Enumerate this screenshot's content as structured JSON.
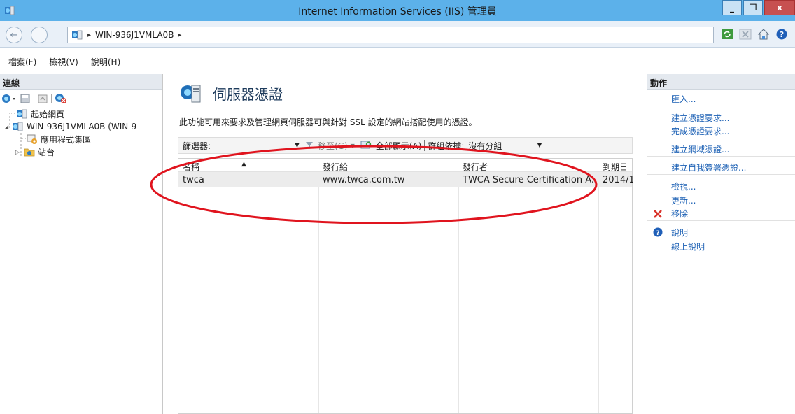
{
  "window": {
    "title": "Internet Information Services (IIS) 管理員",
    "minimize": "_",
    "maximize": "❐",
    "close": "x"
  },
  "address": {
    "path_separator": "▸",
    "server": "WIN-936J1VMLA0B",
    "trailing_separator": "▸"
  },
  "menu": {
    "items": [
      "檔案(F)",
      "檢視(V)",
      "說明(H)"
    ]
  },
  "connections": {
    "header": "連線",
    "tree": [
      {
        "label": "起始網頁"
      },
      {
        "label": "WIN-936J1VMLA0B (WIN-9"
      },
      {
        "label": "應用程式集區"
      },
      {
        "label": "站台"
      }
    ]
  },
  "feature": {
    "title": "伺服器憑證",
    "description": "此功能可用來要求及管理網頁伺服器可與針對 SSL 設定的網站搭配使用的憑證。"
  },
  "filterbar": {
    "filter_label": "篩選器:",
    "go_label": "移至(G)",
    "show_all_label": "全部顯示(A)",
    "group_by_label": "群組依據:",
    "group_by_value": "沒有分組"
  },
  "table": {
    "columns": [
      "名稱",
      "發行給",
      "發行者",
      "到期日"
    ],
    "rows": [
      {
        "name": "twca",
        "issued_to": "www.twca.com.tw",
        "issued_by": "TWCA Secure Certification A...",
        "expires": "2014/1"
      }
    ]
  },
  "actions": {
    "header": "動作",
    "items": [
      {
        "label": "匯入..."
      },
      {
        "label": "建立憑證要求..."
      },
      {
        "label": "完成憑證要求..."
      },
      {
        "label": "建立網域憑證..."
      },
      {
        "label": "建立自我簽署憑證..."
      },
      {
        "label": "檢視..."
      },
      {
        "label": "更新..."
      },
      {
        "label": "移除"
      },
      {
        "label": "說明"
      },
      {
        "label": "線上說明"
      }
    ]
  },
  "colors": {
    "titlebar": "#5cb1ea",
    "close_button": "#c75050",
    "link": "#1a5fb4",
    "annotation": "#e0141e"
  }
}
